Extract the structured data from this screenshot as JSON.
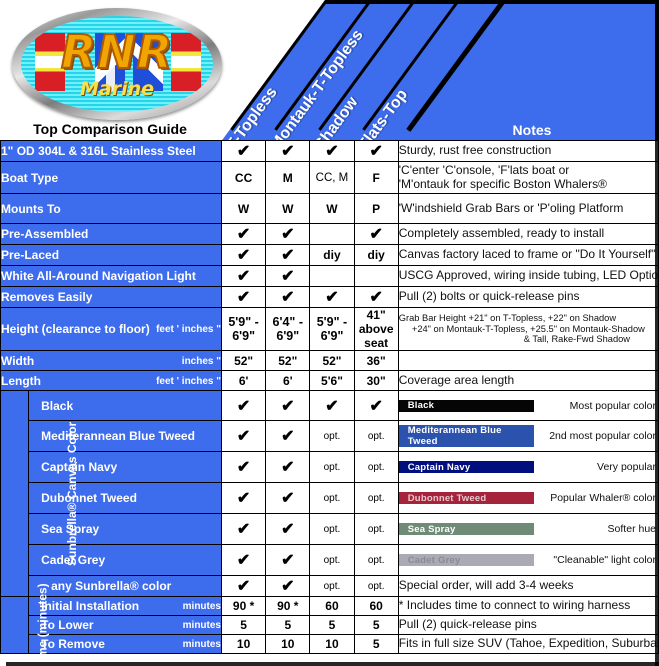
{
  "brand": {
    "logo_text": "RNR",
    "logo_sub": "Marine",
    "guide_title": "Top Comparison Guide"
  },
  "colors": {
    "header_blue": "#3D6CED",
    "label_blue": "#3D6CED",
    "swatch_black": "#050505",
    "swatch_med_blue_tweed": "#2B52AD",
    "swatch_captain_navy": "#000F7E",
    "swatch_dubonnet_tweed": "#A5243B",
    "swatch_sea_spray": "#6F8B76",
    "swatch_cadet_grey": "#AAAAB4"
  },
  "columns": [
    {
      "label": "T-Topless"
    },
    {
      "label": "Montauk-T-Topless"
    },
    {
      "label": "Shadow"
    },
    {
      "label": "Flats-Top"
    }
  ],
  "notes_header": "Notes",
  "group_labels": {
    "canvas_color": "Sunbrella® Canvas Color",
    "time": "Time (minutes)"
  },
  "rows": [
    {
      "label": "1\" OD 304L & 316L Stainless Steel",
      "unit": "",
      "values": [
        "✔",
        "✔",
        "✔",
        "✔"
      ],
      "note": "Sturdy, rust free construction"
    },
    {
      "label": "Boat Type",
      "unit": "",
      "values": [
        "CC",
        "M",
        "CC, M",
        "F"
      ],
      "note_line1": "'C'enter 'C'onsole, 'F'lats boat or",
      "note_line2": "'M'ontauk  for specific Boston Whalers®"
    },
    {
      "label": "Mounts To",
      "unit": "",
      "values": [
        "W",
        "W",
        "W",
        "P"
      ],
      "note": "'W'indshield Grab Bars or 'P'oling Platform"
    },
    {
      "label": "Pre-Assembled",
      "unit": "",
      "values": [
        "✔",
        "✔",
        "",
        "✔"
      ],
      "note": "Completely assembled, ready to install"
    },
    {
      "label": "Pre-Laced",
      "unit": "",
      "values": [
        "✔",
        "✔",
        "diy",
        "diy"
      ],
      "note": "Canvas factory laced to frame or \"Do It Yourself\""
    },
    {
      "label": "White All-Around Navigation Light",
      "unit": "",
      "values": [
        "✔",
        "✔",
        "",
        ""
      ],
      "note": "USCG Approved, wiring inside tubing, LED Optional"
    },
    {
      "label": "Removes Easily",
      "unit": "",
      "values": [
        "✔",
        "✔",
        "✔",
        "✔"
      ],
      "note": "Pull (2) bolts or quick-release pins"
    },
    {
      "label": "Height (clearance to floor)",
      "unit": "feet ' inches \"",
      "values": [
        "5'9\" - 6'9\"",
        "6'4\" - 6'9\"",
        "5'9\" - 6'9\"",
        "41\" above seat"
      ],
      "note_line1": "Grab Bar Height  +21\" on T-Topless, +22\" on Shadow",
      "note_line2": "+24\" on Montauk-T-Topless, +25.5\" on Montauk-Shadow",
      "note_line3": "& Tall, Rake-Fwd Shadow"
    },
    {
      "label": "Width",
      "unit": "inches \"",
      "values": [
        "52\"",
        "52\"",
        "52\"",
        "36\""
      ],
      "note": ""
    },
    {
      "label": "Length",
      "unit": "feet ' inches \"",
      "values": [
        "6'",
        "6'",
        "5'6\"",
        "30\""
      ],
      "note": "Coverage area length"
    }
  ],
  "canvas_colors": [
    {
      "label": "Black",
      "swatch_label": "Black",
      "swatch": "#050505",
      "swatch_text_color": "#ffffff",
      "values": [
        "✔",
        "✔",
        "✔",
        "✔"
      ],
      "note": "Most popular color"
    },
    {
      "label": "Mediterannean Blue Tweed",
      "swatch_label": "Mediterannean Blue Tweed",
      "swatch": "#2B52AD",
      "swatch_text_color": "#ffffff",
      "values": [
        "✔",
        "✔",
        "opt.",
        "opt."
      ],
      "note": "2nd most popular color"
    },
    {
      "label": "Captain Navy",
      "swatch_label": "Captain Navy",
      "swatch": "#000F7E",
      "swatch_text_color": "#ffffff",
      "values": [
        "✔",
        "✔",
        "opt.",
        "opt."
      ],
      "note": "Very popular"
    },
    {
      "label": "Dubonnet Tweed",
      "swatch_label": "Dubonnet Tweed",
      "swatch": "#A5243B",
      "swatch_text_color": "#e8c9ce",
      "values": [
        "✔",
        "✔",
        "opt.",
        "opt."
      ],
      "note": "Popular Whaler® color"
    },
    {
      "label": "Sea Spray",
      "swatch_label": "Sea Spray",
      "swatch": "#6F8B76",
      "swatch_text_color": "#ffffff",
      "values": [
        "✔",
        "✔",
        "opt.",
        "opt."
      ],
      "note": "Softer hue"
    },
    {
      "label": "Cadet Grey",
      "swatch_label": "Cadet Grey",
      "swatch": "#AAAAB4",
      "swatch_text_color": "#8a8a94",
      "values": [
        "✔",
        "✔",
        "opt.",
        "opt."
      ],
      "note": "\"Cleanable\" light color"
    },
    {
      "label": "any Sunbrella® color",
      "swatch_label": "",
      "swatch": "",
      "swatch_text_color": "",
      "values": [
        "✔",
        "✔",
        "opt.",
        "opt."
      ],
      "note": "Special order, will add 3-4 weeks"
    }
  ],
  "time_rows": [
    {
      "label": "Initial Installation",
      "unit": "minutes",
      "values": [
        "90 *",
        "90 *",
        "60",
        "60"
      ],
      "note": "*  Includes time to connect to wiring harness"
    },
    {
      "label": "To Lower",
      "unit": "minutes",
      "values": [
        "5",
        "5",
        "5",
        "5"
      ],
      "note": "Pull (2) quick-release pins"
    },
    {
      "label": "To Remove",
      "unit": "minutes",
      "values": [
        "10",
        "10",
        "10",
        "5"
      ],
      "note": "Fits in full size SUV (Tahoe, Expedition, Suburban)"
    }
  ]
}
